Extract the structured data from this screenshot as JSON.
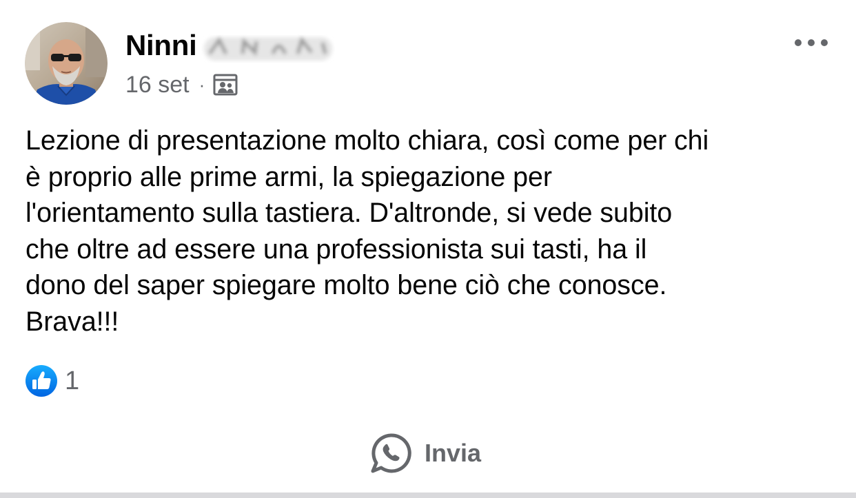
{
  "post": {
    "author": {
      "name": "Ninni",
      "avatar_icon": "profile-photo"
    },
    "meta": {
      "date": "16 set",
      "separator": "·",
      "audience_icon": "group-audience-icon"
    },
    "more_icon": "more-options-icon",
    "text": "Lezione di presentazione molto chiara, così come per chi\nè proprio alle prime armi, la spiegazione per\nl'orientamento sulla tastiera. D'altronde, si vede subito\nche oltre ad essere una professionista sui tasti, ha il\ndono del saper spiegare molto bene ciò che conosce.\nBrava!!!",
    "reactions": {
      "icon": "like-icon",
      "count": "1"
    },
    "actions": {
      "send_label": "Invia",
      "send_icon": "whatsapp-icon"
    }
  },
  "colors": {
    "text_primary": "#050505",
    "text_secondary": "#65676b",
    "like_blue": "#1877f2",
    "divider": "#d9d9dc"
  }
}
